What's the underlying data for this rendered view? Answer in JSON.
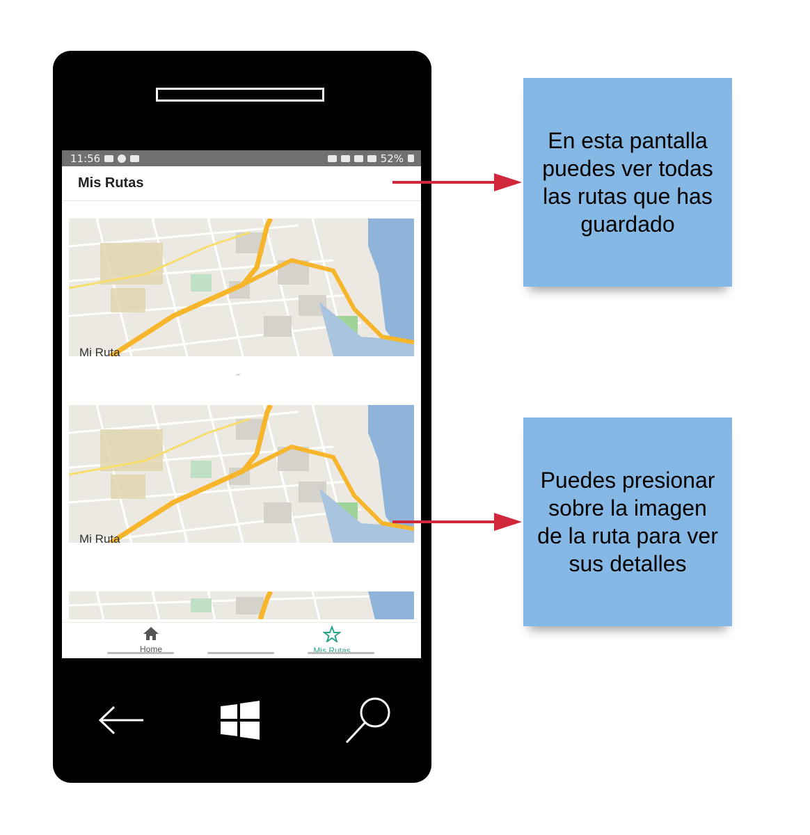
{
  "status_bar": {
    "time": "11:56",
    "battery": "52%"
  },
  "app_bar": {
    "title": "Mis Rutas"
  },
  "routes": [
    {
      "label": "Mi Ruta"
    },
    {
      "label": "Mi Ruta"
    }
  ],
  "bottom_nav": {
    "items": [
      {
        "label": "Home",
        "icon": "home-icon",
        "active": false
      },
      {
        "label": "Mis Rutas",
        "icon": "star-icon",
        "active": true
      }
    ],
    "active_color": "#2aa58a"
  },
  "annotations": [
    {
      "text": "En esta pantalla\npuedes ver  todas\nlas rutas que has\nguardado"
    },
    {
      "text": "Puedes presionar\nsobre la imagen\nde la ruta para ver\nsus detalles"
    }
  ],
  "colors": {
    "note_bg": "#85b8e4",
    "arrow": "#d0283a",
    "route": "#f6b52a",
    "water": "#8fb3d9"
  }
}
